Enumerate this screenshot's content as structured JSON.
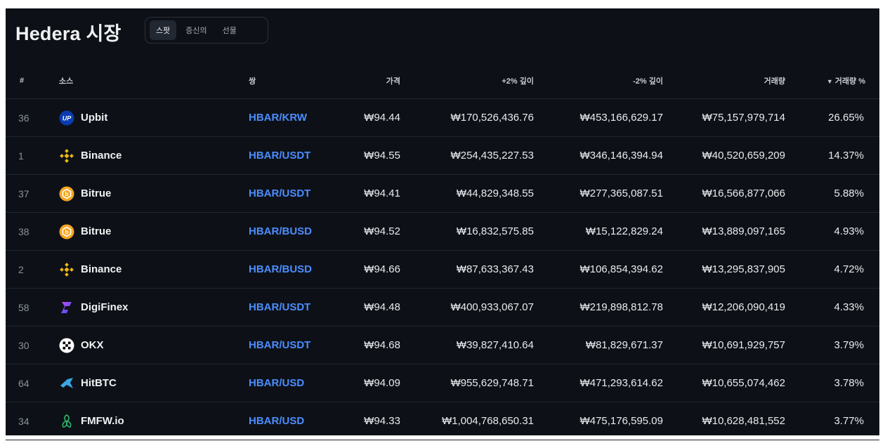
{
  "page": {
    "title": "Hedera 시장",
    "tabs": [
      {
        "label": "스팟",
        "active": true
      },
      {
        "label": "증신의"
      },
      {
        "label": "선물"
      }
    ]
  },
  "table": {
    "headers": {
      "rank": "#",
      "source": "소스",
      "pair": "쌍",
      "price": "가격",
      "depth_plus": "+2% 깊이",
      "depth_minus": "-2% 깊이",
      "volume": "거래량",
      "volume_pct": "거래량 %",
      "sort_indicator": "▼"
    },
    "rows": [
      {
        "rank": "36",
        "source": "Upbit",
        "icon": "upbit-icon",
        "pair": "HBAR/KRW",
        "price": "₩94.44",
        "depth_plus": "₩170,526,436.76",
        "depth_minus": "₩453,166,629.17",
        "volume": "₩75,157,979,714",
        "volume_pct": "26.65%"
      },
      {
        "rank": "1",
        "source": "Binance",
        "icon": "binance-icon",
        "pair": "HBAR/USDT",
        "price": "₩94.55",
        "depth_plus": "₩254,435,227.53",
        "depth_minus": "₩346,146,394.94",
        "volume": "₩40,520,659,209",
        "volume_pct": "14.37%"
      },
      {
        "rank": "37",
        "source": "Bitrue",
        "icon": "bitrue-icon",
        "pair": "HBAR/USDT",
        "price": "₩94.41",
        "depth_plus": "₩44,829,348.55",
        "depth_minus": "₩277,365,087.51",
        "volume": "₩16,566,877,066",
        "volume_pct": "5.88%"
      },
      {
        "rank": "38",
        "source": "Bitrue",
        "icon": "bitrue-icon",
        "pair": "HBAR/BUSD",
        "price": "₩94.52",
        "depth_plus": "₩16,832,575.85",
        "depth_minus": "₩15,122,829.24",
        "volume": "₩13,889,097,165",
        "volume_pct": "4.93%"
      },
      {
        "rank": "2",
        "source": "Binance",
        "icon": "binance-icon",
        "pair": "HBAR/BUSD",
        "price": "₩94.66",
        "depth_plus": "₩87,633,367.43",
        "depth_minus": "₩106,854,394.62",
        "volume": "₩13,295,837,905",
        "volume_pct": "4.72%"
      },
      {
        "rank": "58",
        "source": "DigiFinex",
        "icon": "digifinex-icon",
        "pair": "HBAR/USDT",
        "price": "₩94.48",
        "depth_plus": "₩400,933,067.07",
        "depth_minus": "₩219,898,812.78",
        "volume": "₩12,206,090,419",
        "volume_pct": "4.33%"
      },
      {
        "rank": "30",
        "source": "OKX",
        "icon": "okx-icon",
        "pair": "HBAR/USDT",
        "price": "₩94.68",
        "depth_plus": "₩39,827,410.64",
        "depth_minus": "₩81,829,671.37",
        "volume": "₩10,691,929,757",
        "volume_pct": "3.79%"
      },
      {
        "rank": "64",
        "source": "HitBTC",
        "icon": "hitbtc-icon",
        "pair": "HBAR/USD",
        "price": "₩94.09",
        "depth_plus": "₩955,629,748.71",
        "depth_minus": "₩471,293,614.62",
        "volume": "₩10,655,074,462",
        "volume_pct": "3.78%"
      },
      {
        "rank": "34",
        "source": "FMFW.io",
        "icon": "fmfw-icon",
        "pair": "HBAR/USD",
        "price": "₩94.33",
        "depth_plus": "₩1,004,768,650.31",
        "depth_minus": "₩475,176,595.09",
        "volume": "₩10,628,481,552",
        "volume_pct": "3.77%"
      }
    ]
  },
  "colors": {
    "background": "#0d1117",
    "pair_link": "#4c8dff",
    "binance": "#f0b90b",
    "upbit": "#0a3bb0",
    "bitrue": "#f5a623",
    "digifinex": "#5a3ff0",
    "hitbtc": "#3aa7e6",
    "fmfw": "#2fb46c"
  }
}
